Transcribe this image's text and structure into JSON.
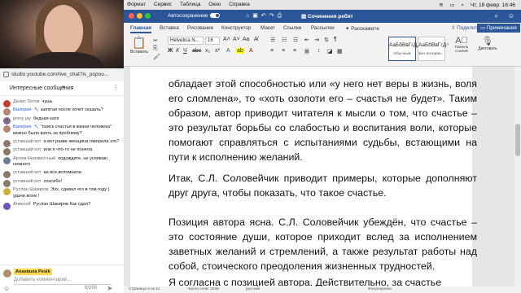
{
  "stream": {
    "url": "studio.youtube.com/live_chat?is_popou...",
    "header": "Интересные сообщения",
    "messages": [
      {
        "author": "Денис Зотов",
        "text": "чушь",
        "color": "#c2412b",
        "blue": false,
        "wrench": false
      },
      {
        "author": "Валерия",
        "text": "запятая после хочет сказать?",
        "color": "#b08a70",
        "blue": true,
        "wrench": true
      },
      {
        "author": "jenny jay",
        "text": "бедная катя",
        "color": "#7b6a8e",
        "blue": false,
        "wrench": false
      },
      {
        "author": "Валерия",
        "text": "\"поиск счастья в жизни человека\" можно было взять за проблему?",
        "color": "#b08a70",
        "blue": true,
        "wrench": true
      },
      {
        "author": "уставший кот",
        "text": "а вот разве женщина говорила это?",
        "color": "#8a7a6a",
        "blue": false,
        "wrench": false
      },
      {
        "author": "уставший кот",
        "text": "или я что-то не поняла",
        "color": "#8a7a6a",
        "blue": false,
        "wrench": false
      },
      {
        "author": "Артем Неизвестный",
        "text": "подождите, не успеваю немного",
        "color": "#6d7f96",
        "blue": false,
        "wrench": false
      },
      {
        "author": "уставший кот",
        "text": "аа все,вспомнила",
        "color": "#8a7a6a",
        "blue": false,
        "wrench": false
      },
      {
        "author": "уставший кот",
        "text": "спасибо!",
        "color": "#8a7a6a",
        "blue": false,
        "wrench": false
      },
      {
        "author": "Руслан Шакиров",
        "text": "Эхх, сдавал егэ в том году ) удачи всем !",
        "color": "#c9b03a",
        "blue": false,
        "wrench": false
      },
      {
        "author": "Алексей",
        "text": "Руслан Шакиров Как сдал?",
        "color": "#6a55b8",
        "blue": false,
        "wrench": false
      }
    ],
    "input": {
      "username": "Anastasia Pesik",
      "placeholder": "Добавить комментарий...",
      "counter": "0/200"
    }
  },
  "menubar": {
    "items": [
      "Формат",
      "Сервис",
      "Таблица",
      "Окно",
      "Справка"
    ],
    "clock": "Чт, 18 февр.  16:46"
  },
  "word": {
    "autosave": "Автосохранение",
    "doc_title": "Сочинения ребят",
    "tabs": [
      "Главная",
      "Вставка",
      "Рисование",
      "Конструктор",
      "Макет",
      "Ссылки",
      "Рассылки",
      "Расскажите"
    ],
    "share": "Поделиться",
    "notes": "Примечания",
    "font_name": "Helvetica N...",
    "font_size": "16",
    "paste": "Вставить",
    "styles": [
      {
        "sample": "АаБбВвГгДд",
        "name": "Обычный",
        "selected": true
      },
      {
        "sample": "АаБбВвГгД",
        "name": "Без интерва...",
        "selected": false
      }
    ],
    "styles_pane": "Панель стилей",
    "dictate": "Диктовать",
    "paragraphs": [
      "обладает этой способностью или «у него нет веры в жизнь, воля его сломлена», то «хоть озолоти его – счастья не будет». Таким образом, автор приводит читателя к мысли о том, что счастье – это результат борьбы со слабостью и воспитания воли, которые помогают справляться с испытаниями судьбы, встающими на пути к исполнению желаний.",
      "Итак, С.Л. Соловейчик приводит примеры, которые дополняют друг друга, чтобы показать, что такое счастье.",
      "Позиция автора ясна. С.Л. Соловейчик убеждён, что счастье – это состояние души, которое приходит вслед за исполнением заветных желаний и стремлений, а также результат работы над собой, стоического преодоления жизненных трудностей.",
      "Я согласна с позицией автора. Действительно, за счастье"
    ],
    "status": {
      "page": "Страница 4 из 11",
      "words": "Число слов: 3436",
      "lang": "русский",
      "focus": "Фокусировка"
    }
  }
}
